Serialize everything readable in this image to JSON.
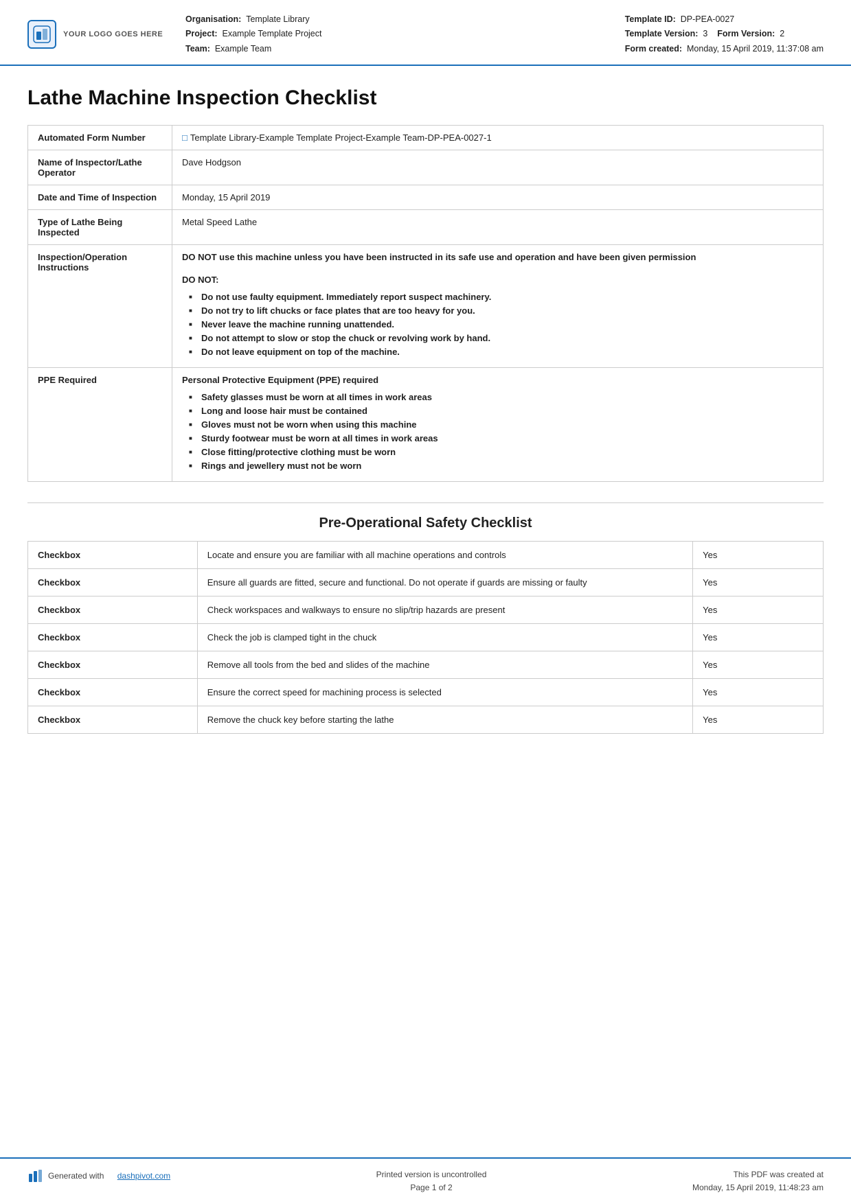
{
  "header": {
    "logo_text": "YOUR LOGO GOES HERE",
    "org_label": "Organisation:",
    "org_value": "Template Library",
    "project_label": "Project:",
    "project_value": "Example Template Project",
    "team_label": "Team:",
    "team_value": "Example Team",
    "template_id_label": "Template ID:",
    "template_id_value": "DP-PEA-0027",
    "template_version_label": "Template Version:",
    "template_version_value": "3",
    "form_version_label": "Form Version:",
    "form_version_value": "2",
    "form_created_label": "Form created:",
    "form_created_value": "Monday, 15 April 2019, 11:37:08 am"
  },
  "document": {
    "title": "Lathe Machine Inspection Checklist"
  },
  "info_rows": [
    {
      "label": "Automated Form Number",
      "value": "Template Library-Example Template Project-Example Team-DP-PEA-0027-1",
      "has_icon": true
    },
    {
      "label": "Name of Inspector/Lathe Operator",
      "value": "Dave Hodgson"
    },
    {
      "label": "Date and Time of Inspection",
      "value": "Monday, 15 April 2019"
    },
    {
      "label": "Type of Lathe Being Inspected",
      "value": "Metal Speed Lathe"
    }
  ],
  "instructions": {
    "label": "Inspection/Operation Instructions",
    "main_text": "DO NOT use this machine unless you have been instructed in its safe use and operation and have been given permission",
    "do_not_label": "DO NOT:",
    "do_not_items": [
      "Do not use faulty equipment. Immediately report suspect machinery.",
      "Do not try to lift chucks or face plates that are too heavy for you.",
      "Never leave the machine running unattended.",
      "Do not attempt to slow or stop the chuck or revolving work by hand.",
      "Do not leave equipment on top of the machine."
    ]
  },
  "ppe": {
    "label": "PPE Required",
    "title": "Personal Protective Equipment (PPE) required",
    "items": [
      "Safety glasses must be worn at all times in work areas",
      "Long and loose hair must be contained",
      "Gloves must not be worn when using this machine",
      "Sturdy footwear must be worn at all times in work areas",
      "Close fitting/protective clothing must be worn",
      "Rings and jewellery must not be worn"
    ]
  },
  "checklist_section": {
    "heading": "Pre-Operational Safety Checklist"
  },
  "checklist_rows": [
    {
      "label": "Checkbox",
      "description": "Locate and ensure you are familiar with all machine operations and controls",
      "value": "Yes"
    },
    {
      "label": "Checkbox",
      "description": "Ensure all guards are fitted, secure and functional. Do not operate if guards are missing or faulty",
      "value": "Yes"
    },
    {
      "label": "Checkbox",
      "description": "Check workspaces and walkways to ensure no slip/trip hazards are present",
      "value": "Yes"
    },
    {
      "label": "Checkbox",
      "description": "Check the job is clamped tight in the chuck",
      "value": "Yes"
    },
    {
      "label": "Checkbox",
      "description": "Remove all tools from the bed and slides of the machine",
      "value": "Yes"
    },
    {
      "label": "Checkbox",
      "description": "Ensure the correct speed for machining process is selected",
      "value": "Yes"
    },
    {
      "label": "Checkbox",
      "description": "Remove the chuck key before starting the lathe",
      "value": "Yes"
    }
  ],
  "footer": {
    "generated_text": "Generated with",
    "link_text": "dashpivot.com",
    "uncontrolled_text": "Printed version is uncontrolled",
    "page_text": "Page 1 of 2",
    "pdf_created_label": "This PDF was created at",
    "pdf_created_value": "Monday, 15 April 2019, 11:48:23 am"
  }
}
